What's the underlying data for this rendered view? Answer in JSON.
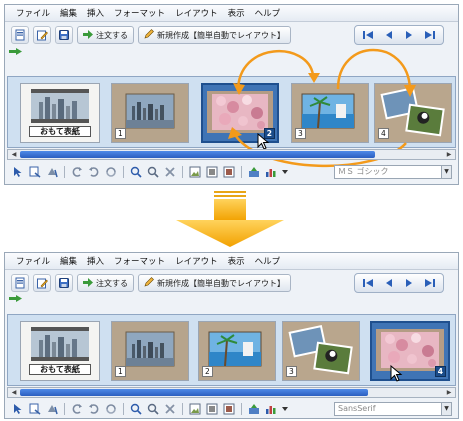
{
  "menu": [
    "ファイル",
    "編集",
    "挿入",
    "フォーマット",
    "レイアウト",
    "表示",
    "ヘルプ"
  ],
  "toolbar": {
    "order_label": "注文する",
    "new_label": "新規作成【簡単自動でレイアウト】"
  },
  "before": {
    "pages": [
      {
        "kind": "cover",
        "label": "おもて表紙",
        "num": ""
      },
      {
        "kind": "city",
        "num": "1"
      },
      {
        "kind": "blossom",
        "num": "2",
        "selected": true
      },
      {
        "kind": "beach",
        "num": "3"
      },
      {
        "kind": "collage",
        "num": "4"
      }
    ],
    "font": "ＭＳ ゴシック"
  },
  "after": {
    "pages": [
      {
        "kind": "cover",
        "label": "おもて表紙",
        "num": ""
      },
      {
        "kind": "city",
        "num": "1"
      },
      {
        "kind": "beach",
        "num": "2"
      },
      {
        "kind": "collage",
        "num": "3"
      },
      {
        "kind": "blossom",
        "num": "4",
        "selected": true
      }
    ],
    "font": "SansSerif"
  },
  "colors": {
    "accent": "#f39a1b",
    "selection": "#3f74b5",
    "scroll": "#3a6fd6"
  },
  "icons": {
    "toolbar": [
      "new-document-icon",
      "edit-icon",
      "save-icon"
    ],
    "nav": [
      "first-page-icon",
      "previous-page-icon",
      "next-page-icon",
      "last-page-icon"
    ],
    "bottom": [
      "select-pointer-icon",
      "text-frame-icon",
      "fill-icon",
      "rotate-left-icon",
      "rotate-right-icon",
      "refresh-icon",
      "zoom-in-icon",
      "zoom-out-icon",
      "delete-icon",
      "layout-image-icon",
      "layout-image-icon-2",
      "layout-image-icon-3",
      "import-photo-icon",
      "chart-icon"
    ]
  }
}
